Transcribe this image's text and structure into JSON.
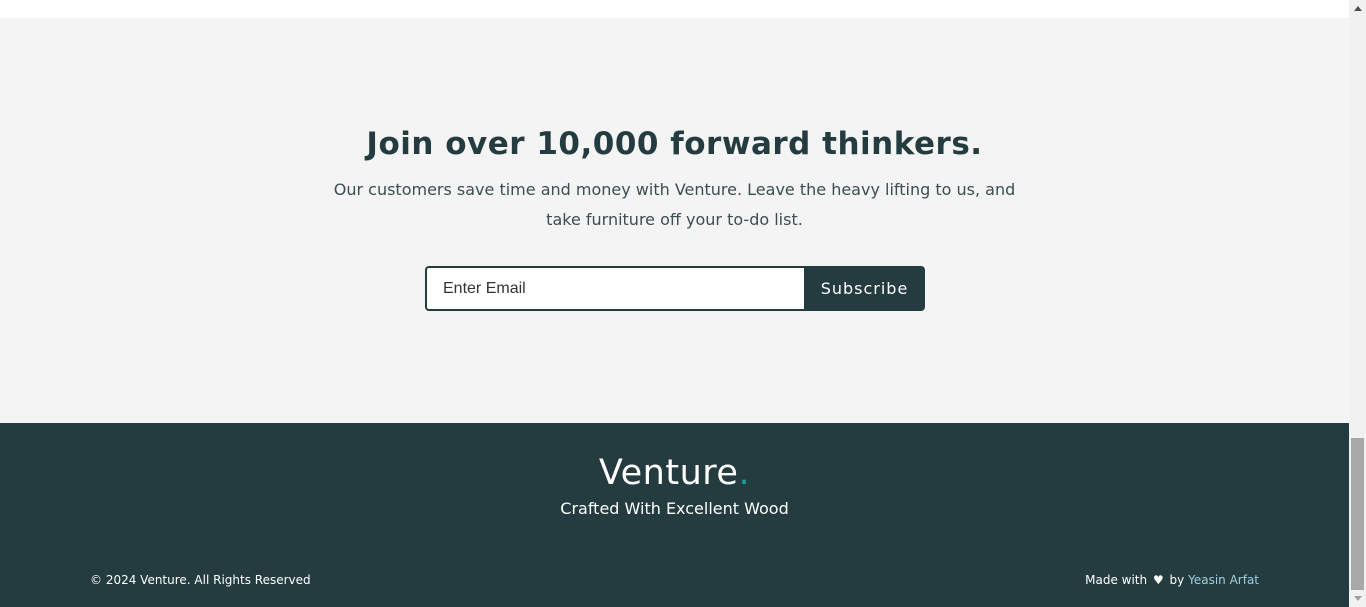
{
  "newsletter": {
    "title": "Join over 10,000 forward thinkers.",
    "description": "Our customers save time and money with Venture. Leave the heavy lifting to us, and take furniture off your to-do list.",
    "email_placeholder": "Enter Email",
    "email_value": "",
    "subscribe_label": "Subscribe"
  },
  "footer": {
    "brand_name": "Venture",
    "brand_dot": ".",
    "tagline": "Crafted With Excellent Wood",
    "copyright": "© 2024 Venture. All Rights Reserved",
    "made_with_prefix": "Made with",
    "heart": "♥",
    "made_with_by": "by",
    "author": "Yeasin Arfat"
  },
  "icons": {
    "heart": "heart-icon",
    "scroll_up": "scroll-up-arrow-icon",
    "scroll_down": "scroll-down-arrow-icon"
  },
  "colors": {
    "dark_green": "#243c3f",
    "light_bg": "#f3f4f3",
    "accent_teal": "#16a39a",
    "link_blue": "#9fd0e0"
  }
}
